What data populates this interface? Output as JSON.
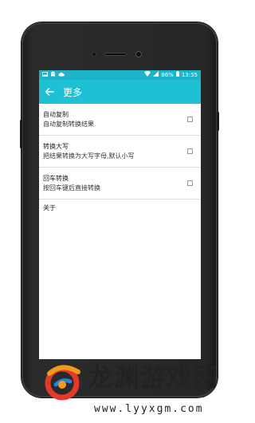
{
  "status_bar": {
    "left_icons": [
      "image-icon",
      "android-icon",
      "cloud-icon"
    ],
    "battery": "86%",
    "time": "13:55"
  },
  "app_bar": {
    "title": "更多"
  },
  "settings": [
    {
      "title": "自动复制",
      "summary": "自动复制转换结果",
      "checked": false
    },
    {
      "title": "转换大写",
      "summary": "把结果转换为大写字母,默认小写",
      "checked": false
    },
    {
      "title": "回车转换",
      "summary": "按回车键后直接转换",
      "checked": false
    }
  ],
  "about": {
    "label": "关于"
  },
  "watermark": {
    "brand": "龙渊游戏网",
    "url": "www.lyyxgm.com"
  },
  "colors": {
    "accent": "#1ec0d5",
    "status_bar": "#1fb3c8"
  }
}
